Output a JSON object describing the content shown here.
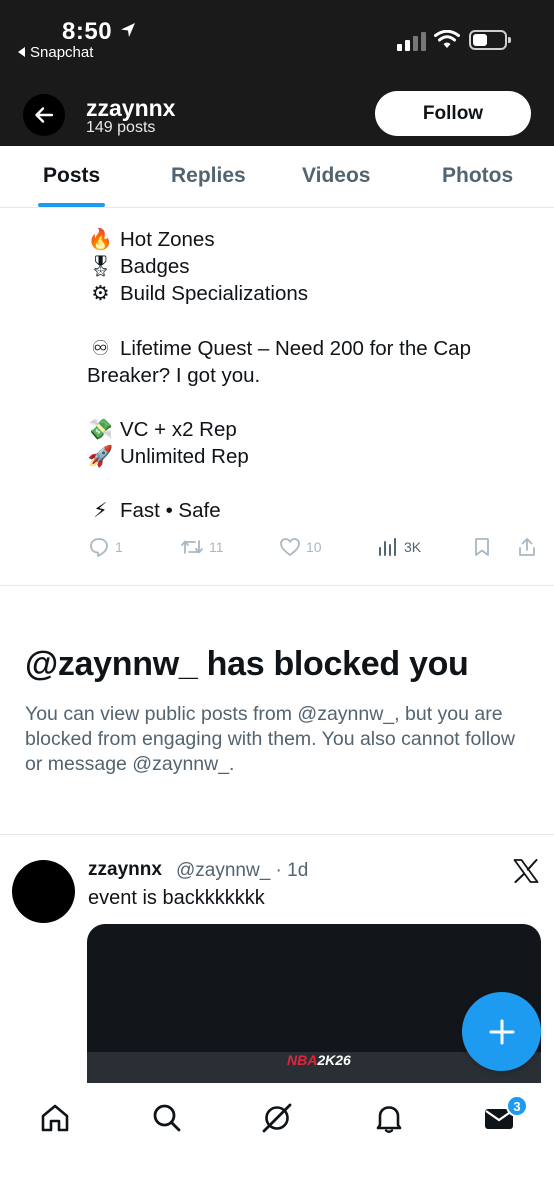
{
  "status_bar": {
    "time": "8:50",
    "back_app": "Snapchat"
  },
  "header": {
    "name": "zzaynnx",
    "post_count": "149 posts",
    "follow_label": "Follow"
  },
  "tabs": [
    {
      "label": "Posts",
      "active": true
    },
    {
      "label": "Replies",
      "active": false
    },
    {
      "label": "Videos",
      "active": false
    },
    {
      "label": "Photos",
      "active": false
    }
  ],
  "post1": {
    "lines": [
      {
        "emoji": "🔥",
        "text": "Hot Zones"
      },
      {
        "emoji": "🎖",
        "text": "Badges"
      },
      {
        "emoji": "⚙",
        "text": "Build Specializations"
      },
      {
        "emoji": "♾",
        "text": "Lifetime Quest – Need 200 for the Cap Breaker? I got you."
      },
      {
        "emoji": "💸",
        "text": "VC + x2 Rep"
      },
      {
        "emoji": "🚀",
        "text": "Unlimited Rep"
      },
      {
        "emoji": "⚡",
        "text": "Fast • Safe"
      }
    ],
    "actions": {
      "replies": "1",
      "reposts": "11",
      "likes": "10",
      "views": "3K"
    }
  },
  "blocked": {
    "title": "@zaynnw_ has blocked you",
    "description": "You can view public posts from @zaynnw_, but you are blocked from engaging with them. You also cannot follow or message @zaynnw_."
  },
  "post2": {
    "name": "zzaynnx",
    "handle_time": "@zaynnw_ · 1d",
    "text": "event is backkkkkkk",
    "media_label_prefix": "NBA",
    "media_label": "2K26"
  },
  "bottom_nav": {
    "messages_badge": "3"
  },
  "colors": {
    "accent": "#1d9bf0",
    "header_bg": "#1a1a1a",
    "text_primary": "#0f1419",
    "text_secondary": "#536471"
  }
}
